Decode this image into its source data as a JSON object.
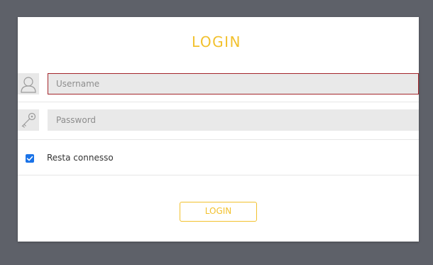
{
  "login": {
    "title": "LOGIN",
    "username": {
      "placeholder": "Username",
      "value": "",
      "icon": "user-icon"
    },
    "password": {
      "placeholder": "Password",
      "value": "",
      "icon": "key-icon"
    },
    "remember": {
      "label": "Resta connesso",
      "checked": true
    },
    "submit_label": "LOGIN",
    "accent_color": "#f2c12e",
    "focus_color": "#a4262c",
    "checkbox_color": "#1a73e8"
  }
}
